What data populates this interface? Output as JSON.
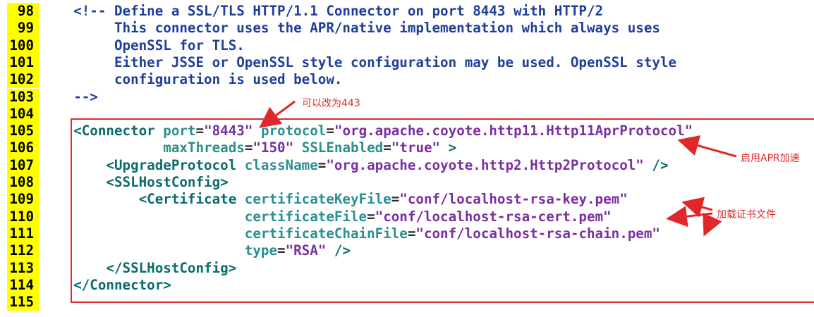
{
  "line_numbers": [
    "98",
    "99",
    "100",
    "101",
    "102",
    "103",
    "104",
    "105",
    "106",
    "107",
    "108",
    "109",
    "110",
    "111",
    "112",
    "113",
    "114",
    "115"
  ],
  "lines": [
    [
      [
        "comment",
        "    <!-- Define a SSL/TLS HTTP/1.1 Connector on port 8443 with HTTP/2"
      ]
    ],
    [
      [
        "comment",
        "         This connector uses the APR/native implementation which always uses"
      ]
    ],
    [
      [
        "comment",
        "         OpenSSL for TLS."
      ]
    ],
    [
      [
        "comment",
        "         Either JSSE or OpenSSL style configuration may be used. OpenSSL style"
      ]
    ],
    [
      [
        "comment",
        "         configuration is used below."
      ]
    ],
    [
      [
        "comment",
        "    -->"
      ]
    ],
    [],
    [
      [
        "tag",
        "    <Connector "
      ],
      [
        "attr",
        "port"
      ],
      [
        "punc",
        "="
      ],
      [
        "str",
        "\"8443\""
      ],
      [
        "punc",
        " "
      ],
      [
        "attr",
        "protocol"
      ],
      [
        "punc",
        "="
      ],
      [
        "str",
        "\"org.apache.coyote.http11.Http11AprProtocol\""
      ]
    ],
    [
      [
        "punc",
        "               "
      ],
      [
        "attr",
        "maxThreads"
      ],
      [
        "punc",
        "="
      ],
      [
        "str",
        "\"150\""
      ],
      [
        "punc",
        " "
      ],
      [
        "attr",
        "SSLEnabled"
      ],
      [
        "punc",
        "="
      ],
      [
        "str",
        "\"true\""
      ],
      [
        "tag",
        " >"
      ]
    ],
    [
      [
        "tag",
        "        <UpgradeProtocol "
      ],
      [
        "attr",
        "className"
      ],
      [
        "punc",
        "="
      ],
      [
        "str",
        "\"org.apache.coyote.http2.Http2Protocol\""
      ],
      [
        "tag",
        " />"
      ]
    ],
    [
      [
        "tag",
        "        <SSLHostConfig>"
      ]
    ],
    [
      [
        "tag",
        "            <Certificate "
      ],
      [
        "attr",
        "certificateKeyFile"
      ],
      [
        "punc",
        "="
      ],
      [
        "str",
        "\"conf/localhost-rsa-key.pem\""
      ]
    ],
    [
      [
        "punc",
        "                         "
      ],
      [
        "attr",
        "certificateFile"
      ],
      [
        "punc",
        "="
      ],
      [
        "str",
        "\"conf/localhost-rsa-cert.pem\""
      ]
    ],
    [
      [
        "punc",
        "                         "
      ],
      [
        "attr",
        "certificateChainFile"
      ],
      [
        "punc",
        "="
      ],
      [
        "str",
        "\"conf/localhost-rsa-chain.pem\""
      ]
    ],
    [
      [
        "punc",
        "                         "
      ],
      [
        "attr",
        "type"
      ],
      [
        "punc",
        "="
      ],
      [
        "str",
        "\"RSA\""
      ],
      [
        "tag",
        " />"
      ]
    ],
    [
      [
        "tag",
        "        </SSLHostConfig>"
      ]
    ],
    [
      [
        "tag",
        "    </Connector>"
      ]
    ],
    []
  ],
  "annotations": {
    "port_note": "可以改为443",
    "apr_note": "启用APR加速",
    "cert_note": "加载证书文件"
  },
  "colors": {
    "gutter": "#ffff00",
    "comment": "#1f3e9a",
    "tag": "#0b6b6b",
    "attr": "#2a8f8f",
    "string": "#7a2fa0",
    "annotation": "#e0282c"
  }
}
